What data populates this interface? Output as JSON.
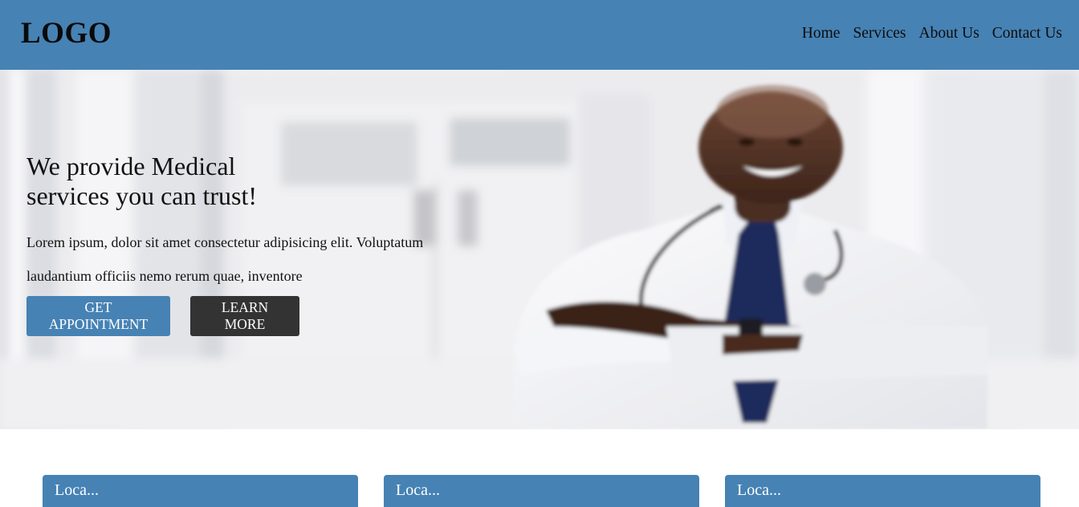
{
  "header": {
    "logo": "LOGO",
    "nav": [
      {
        "label": "Home"
      },
      {
        "label": "Services"
      },
      {
        "label": "About Us"
      },
      {
        "label": "Contact Us"
      }
    ]
  },
  "hero": {
    "title": "We provide Medical services you can trust!",
    "text": "Lorem ipsum, dolor sit amet consectetur adipisicing elit. Voluptatum laudantium officiis nemo rerum quae, inventore",
    "buttons": {
      "appointment": "GET APPOINTMENT",
      "learn_more": "LEARN MORE"
    }
  },
  "cards": [
    {
      "title": "Loca..."
    },
    {
      "title": "Loca..."
    },
    {
      "title": "Loca..."
    }
  ],
  "colors": {
    "brand": "#4682b4",
    "dark_button": "#333333"
  }
}
